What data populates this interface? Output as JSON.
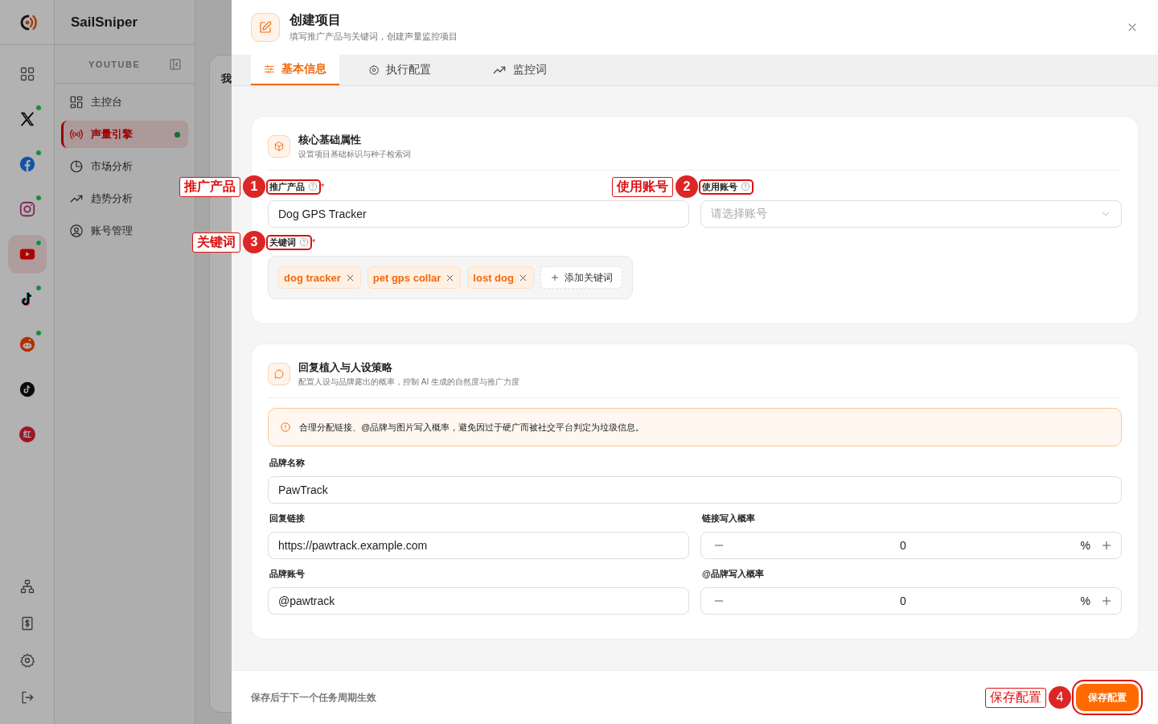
{
  "app": {
    "name": "SailSniper"
  },
  "rail": {
    "platforms": [
      {
        "kind": "grid",
        "online": false,
        "selected": false
      },
      {
        "kind": "x",
        "online": true,
        "selected": false
      },
      {
        "kind": "facebook",
        "online": true,
        "selected": false
      },
      {
        "kind": "instagram",
        "online": true,
        "selected": false
      },
      {
        "kind": "youtube",
        "online": true,
        "selected": true
      },
      {
        "kind": "tiktok",
        "online": true,
        "selected": false
      },
      {
        "kind": "reddit",
        "online": true,
        "selected": false
      },
      {
        "kind": "tiktok-round",
        "online": false,
        "selected": false
      },
      {
        "kind": "xiaohongshu",
        "label": "红",
        "online": false,
        "selected": false
      }
    ],
    "bottom": [
      {
        "kind": "org"
      },
      {
        "kind": "billing"
      },
      {
        "kind": "settings"
      },
      {
        "kind": "logout"
      }
    ]
  },
  "sidebar": {
    "section": "YOUTUBE",
    "items": [
      {
        "label": "主控台",
        "selected": false,
        "live": false
      },
      {
        "label": "声量引擎",
        "selected": true,
        "live": true
      },
      {
        "label": "市场分析",
        "selected": false,
        "live": false
      },
      {
        "label": "趋势分析",
        "selected": false,
        "live": false
      },
      {
        "label": "账号管理",
        "selected": false,
        "live": false
      }
    ]
  },
  "background": {
    "heading": "我"
  },
  "drawer": {
    "title": "创建项目",
    "subtitle": "填写推广产品与关键词，创建声量监控项目",
    "tabs": [
      {
        "label": "基本信息",
        "selected": true
      },
      {
        "label": "执行配置",
        "selected": false
      },
      {
        "label": "监控词",
        "selected": false
      }
    ],
    "sections": [
      {
        "title": "核心基础属性",
        "subtitle": "设置项目基础标识与种子检索词",
        "rows": [
          [
            {
              "kind": "text",
              "label": "推广产品",
              "help": true,
              "required_mark": "*",
              "value": "Dog GPS Tracker",
              "annotation": {
                "number": "1",
                "label": "推广产品"
              }
            },
            {
              "kind": "select",
              "label": "使用账号",
              "help": true,
              "placeholder": "请选择账号",
              "annotation": {
                "number": "2",
                "label": "使用账号"
              }
            }
          ],
          [
            {
              "kind": "tags",
              "label": "关键词",
              "help": true,
              "required_mark": "*",
              "tags": [
                "dog tracker",
                "pet gps collar",
                "lost dog"
              ],
              "add_label": "添加关键词",
              "annotation": {
                "number": "3",
                "label": "关键词"
              }
            }
          ]
        ]
      },
      {
        "title": "回复植入与人设策略",
        "subtitle": "配置人设与品牌露出的概率，控制 AI 生成的自然度与推广力度",
        "notice": "合理分配链接、@品牌与图片写入概率，避免因过于硬广而被社交平台判定为垃圾信息。",
        "rows": [
          [
            {
              "kind": "text",
              "label": "品牌名称",
              "value": "PawTrack"
            }
          ],
          [
            {
              "kind": "text",
              "label": "回复链接",
              "value": "https://pawtrack.example.com"
            },
            {
              "kind": "stepper",
              "label": "链接写入概率",
              "value": "0",
              "unit": "%"
            }
          ],
          [
            {
              "kind": "text",
              "label": "品牌账号",
              "value": "@pawtrack"
            },
            {
              "kind": "stepper",
              "label": "@品牌写入概率",
              "value": "0",
              "unit": "%"
            }
          ]
        ]
      }
    ],
    "footer": {
      "note": "保存后于下一个任务周期生效",
      "primary": {
        "label": "保存配置",
        "annotation": {
          "number": "4",
          "label": "保存配置"
        }
      }
    }
  }
}
